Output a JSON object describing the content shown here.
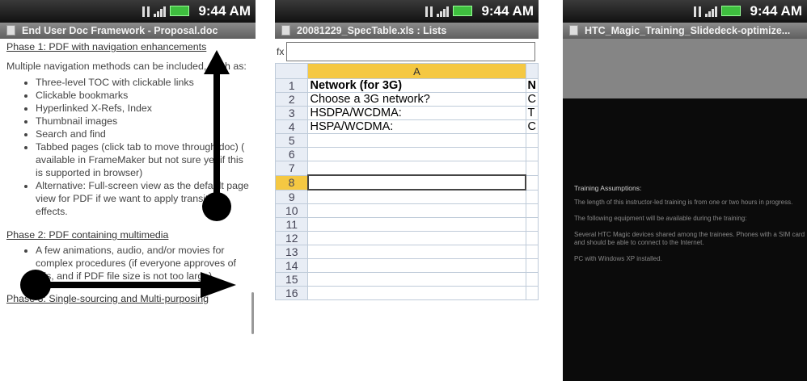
{
  "status": {
    "time": "9:44 AM"
  },
  "screen1": {
    "title": "End User Doc Framework - Proposal.doc",
    "phase1": "Phase 1: PDF with navigation enhancements",
    "intro": "Multiple navigation methods can be included, such as:",
    "bullets": [
      "Three-level TOC with clickable links",
      "Clickable bookmarks",
      "Hyperlinked X-Refs, Index",
      "Thumbnail images",
      "Search and find",
      "Tabbed pages (click tab to move through doc) ( available in FrameMaker but not sure yet if this is supported in browser)",
      "Alternative: Full-screen view as the default page view for PDF if we want to apply transition effects."
    ],
    "phase2": "Phase 2: PDF containing multimedia",
    "bullets2": [
      "A few animations, audio, and/or movies for complex procedures (if everyone approves of this, and if PDF file size is not too large)"
    ],
    "phase3": "Phase 3: Single-sourcing and Multi-purposing"
  },
  "screen2": {
    "title": "20081229_SpecTable.xls : Lists",
    "fx_label": "fx",
    "column_header": "A",
    "column_b_partial": "N",
    "rows": [
      {
        "num": "1",
        "a": "Network (for 3G)",
        "b": "N"
      },
      {
        "num": "2",
        "a": "Choose a 3G network?",
        "b": "C"
      },
      {
        "num": "3",
        "a": "HSDPA/WCDMA:",
        "b": "T"
      },
      {
        "num": "4",
        "a": "HSPA/WCDMA:",
        "b": "C"
      },
      {
        "num": "5",
        "a": "",
        "b": ""
      },
      {
        "num": "6",
        "a": "",
        "b": ""
      },
      {
        "num": "7",
        "a": "",
        "b": ""
      },
      {
        "num": "8",
        "a": "",
        "b": ""
      },
      {
        "num": "9",
        "a": "",
        "b": ""
      },
      {
        "num": "10",
        "a": "",
        "b": ""
      },
      {
        "num": "11",
        "a": "",
        "b": ""
      },
      {
        "num": "12",
        "a": "",
        "b": ""
      },
      {
        "num": "13",
        "a": "",
        "b": ""
      },
      {
        "num": "14",
        "a": "",
        "b": ""
      },
      {
        "num": "15",
        "a": "",
        "b": ""
      },
      {
        "num": "16",
        "a": "",
        "b": ""
      }
    ]
  },
  "screen3": {
    "title": "HTC_Magic_Training_Slidedeck-optimize...",
    "heading": "Training Assumptions:",
    "paragraphs": [
      "The length of this instructor-led training is from one or two hours in progress.",
      "The following equipment will be available during the training:",
      "Several HTC Magic devices shared among the trainees. Phones with a SIM card and should be able to connect to the Internet.",
      "PC with Windows XP installed."
    ]
  }
}
